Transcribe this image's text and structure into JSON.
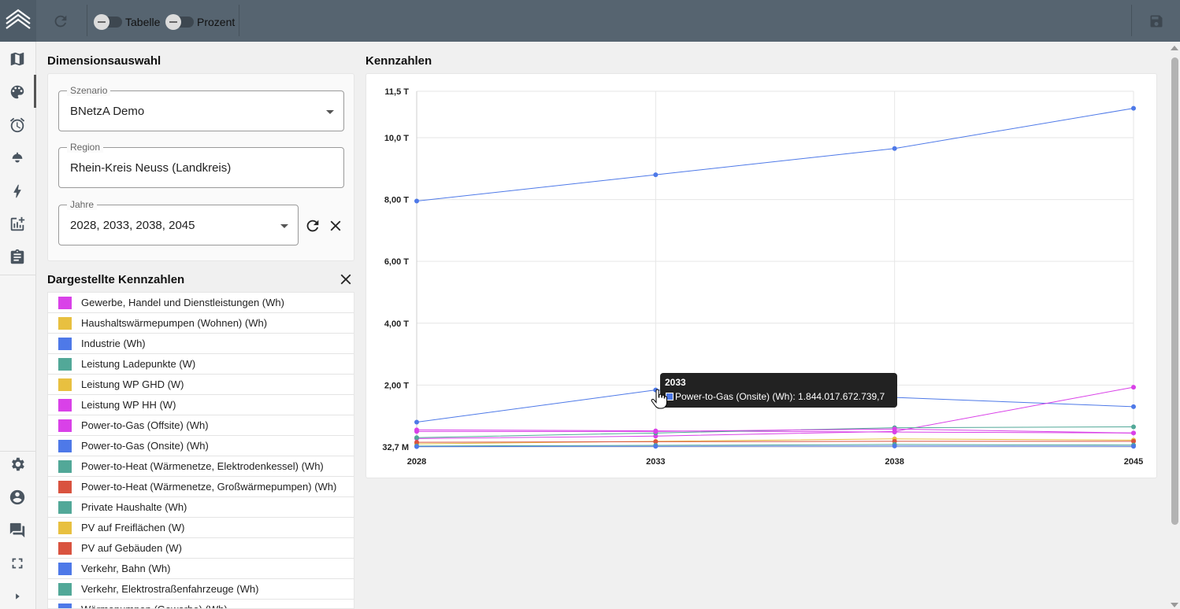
{
  "toolbar": {
    "toggle_table_label": "Tabelle",
    "toggle_percent_label": "Prozent"
  },
  "dimension": {
    "title": "Dimensionsauswahl",
    "scenario_label": "Szenario",
    "scenario_value": "BNetzA Demo",
    "region_label": "Region",
    "region_value": "Rhein-Kreis Neuss (Landkreis)",
    "years_label": "Jahre",
    "years_value": "2028, 2033, 2038, 2045"
  },
  "kpi_list": {
    "title": "Dargestellte Kennzahlen",
    "items": [
      {
        "label": "Gewerbe, Handel und Dienstleistungen (Wh)",
        "color": "#d941e8"
      },
      {
        "label": "Haushaltswärmepumpen (Wohnen) (Wh)",
        "color": "#e8c040"
      },
      {
        "label": "Industrie (Wh)",
        "color": "#4e79e8"
      },
      {
        "label": "Leistung Ladepunkte (W)",
        "color": "#52a898"
      },
      {
        "label": "Leistung WP GHD (W)",
        "color": "#e8c040"
      },
      {
        "label": "Leistung WP HH (W)",
        "color": "#d941e8"
      },
      {
        "label": "Power-to-Gas (Offsite) (Wh)",
        "color": "#d941e8"
      },
      {
        "label": "Power-to-Gas (Onsite) (Wh)",
        "color": "#4e79e8"
      },
      {
        "label": "Power-to-Heat (Wärmenetze, Elektrodenkessel) (Wh)",
        "color": "#52a898"
      },
      {
        "label": "Power-to-Heat (Wärmenetze, Großwärmepumpen) (Wh)",
        "color": "#d9533f"
      },
      {
        "label": "Private Haushalte (Wh)",
        "color": "#52a898"
      },
      {
        "label": "PV auf Freiflächen (W)",
        "color": "#e8c040"
      },
      {
        "label": "PV auf Gebäuden (W)",
        "color": "#d9533f"
      },
      {
        "label": "Verkehr, Bahn (Wh)",
        "color": "#4e79e8"
      },
      {
        "label": "Verkehr, Elektrostraßenfahrzeuge (Wh)",
        "color": "#52a898"
      },
      {
        "label": "Wärmepumpen (Gewerbe) (Wh)",
        "color": "#4e79e8"
      }
    ]
  },
  "chart_section": {
    "title": "Kennzahlen"
  },
  "tooltip": {
    "title": "2033",
    "text": "Power-to-Gas (Onsite) (Wh): 1.844.017.672.739,7"
  },
  "chart_data": {
    "type": "line",
    "x": [
      "2028",
      "2033",
      "2038",
      "2045"
    ],
    "ytick_labels": [
      "32,7 M",
      "2,00 T",
      "4,00 T",
      "6,00 T",
      "8,00 T",
      "10,0 T",
      "11,5 T"
    ],
    "ytick_values": [
      3.27e-05,
      2.0,
      4.0,
      6.0,
      8.0,
      10.0,
      11.5
    ],
    "ylim": [
      3.27e-05,
      11.5
    ],
    "y_unit": "T",
    "grid": true,
    "series": [
      {
        "name": "Industrie (Wh)",
        "color": "#4e79e8",
        "values": [
          7.95,
          8.8,
          9.65,
          10.95
        ]
      },
      {
        "name": "Power-to-Gas (Onsite) (Wh)",
        "color": "#4e79e8",
        "values": [
          0.8,
          1.84,
          1.6,
          1.3
        ]
      },
      {
        "name": "Power-to-Gas (Offsite) (Wh)",
        "color": "#d941e8",
        "values": [
          0.27,
          0.35,
          0.5,
          1.93
        ]
      },
      {
        "name": "Gewerbe, Handel und Dienstleistungen (Wh)",
        "color": "#d941e8",
        "values": [
          0.55,
          0.52,
          0.48,
          0.45
        ]
      },
      {
        "name": "Private Haushalte (Wh)",
        "color": "#52a898",
        "values": [
          0.3,
          0.45,
          0.62,
          0.65
        ]
      },
      {
        "name": "Leistung WP HH (W)",
        "color": "#d941e8",
        "values": [
          0.5,
          0.5,
          0.58,
          0.45
        ]
      },
      {
        "name": "Haushaltswärmepumpen (Wohnen) (Wh)",
        "color": "#e8c040",
        "values": [
          0.1,
          0.18,
          0.26,
          0.22
        ]
      },
      {
        "name": "Power-to-Heat (Wärmenetze, Großwärmepumpen) (Wh)",
        "color": "#d9533f",
        "values": [
          0.15,
          0.17,
          0.18,
          0.18
        ]
      },
      {
        "name": "Verkehr, Elektrostraßenfahrzeuge (Wh)",
        "color": "#52a898",
        "values": [
          0.03,
          0.05,
          0.08,
          0.06
        ]
      },
      {
        "name": "Verkehr, Bahn (Wh)",
        "color": "#4e79e8",
        "values": [
          0.01,
          0.02,
          0.03,
          0.02
        ]
      }
    ]
  }
}
